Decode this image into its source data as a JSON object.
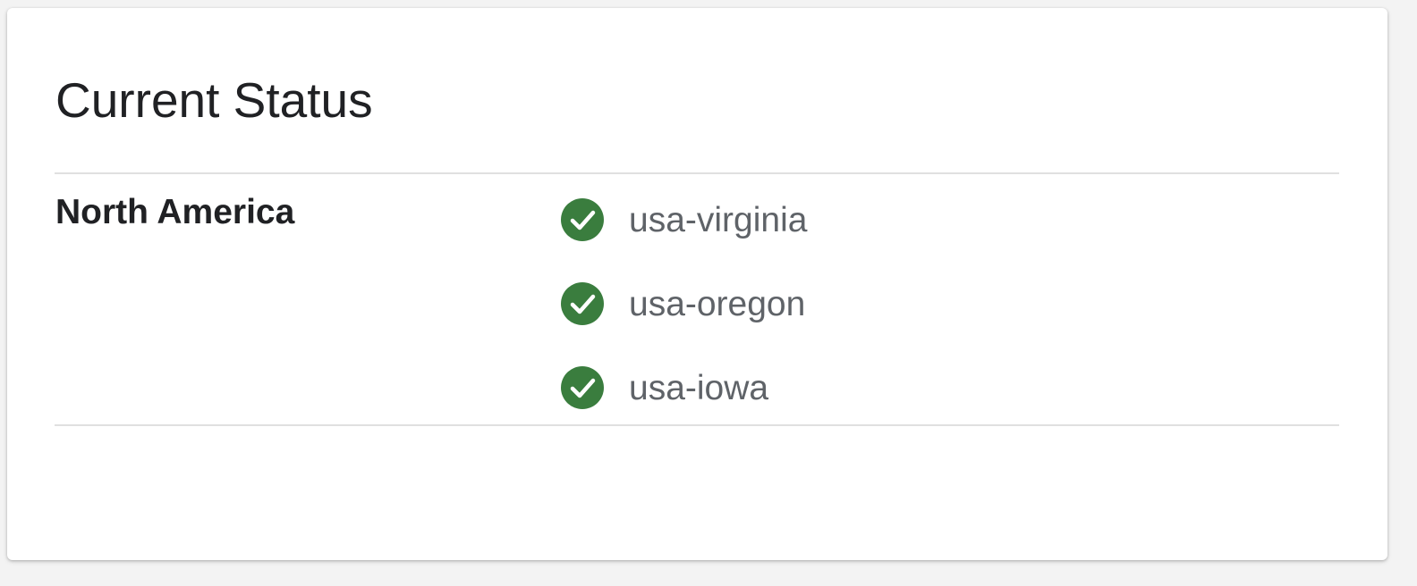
{
  "status_card": {
    "title": "Current Status",
    "colors": {
      "ok": "#3a7d3e",
      "divider": "#e0e0e0",
      "region_text": "#202124",
      "location_text": "#5f6368"
    },
    "regions": [
      {
        "name": "North America",
        "locations": [
          {
            "name": "usa-virginia",
            "status": "ok",
            "icon": "check-circle-icon"
          },
          {
            "name": "usa-oregon",
            "status": "ok",
            "icon": "check-circle-icon"
          },
          {
            "name": "usa-iowa",
            "status": "ok",
            "icon": "check-circle-icon"
          }
        ]
      }
    ]
  }
}
